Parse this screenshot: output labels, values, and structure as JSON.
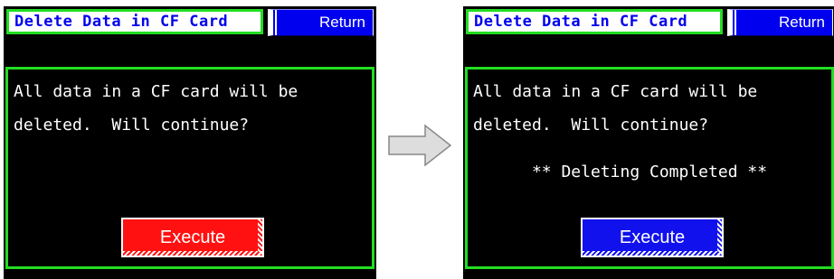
{
  "screens": [
    {
      "title": "Delete Data in CF Card",
      "return_label": "Return",
      "message": "All data in a CF card will be\ndeleted.  Will continue?",
      "status": "",
      "execute_label": "Execute",
      "execute_color": "#ff1111"
    },
    {
      "title": "Delete Data in CF Card",
      "return_label": "Return",
      "message": "All data in a CF card will be\ndeleted.  Will continue?",
      "status": "** Deleting Completed **",
      "execute_label": "Execute",
      "execute_color": "#1111ee"
    }
  ],
  "colors": {
    "screen_bg": "#000000",
    "frame_green": "#22dd22",
    "title_text": "#0000ee",
    "return_bg": "#0000ee",
    "arrow_fill": "#dddddd",
    "arrow_stroke": "#888888"
  },
  "arrow_icon": "right-arrow-icon"
}
